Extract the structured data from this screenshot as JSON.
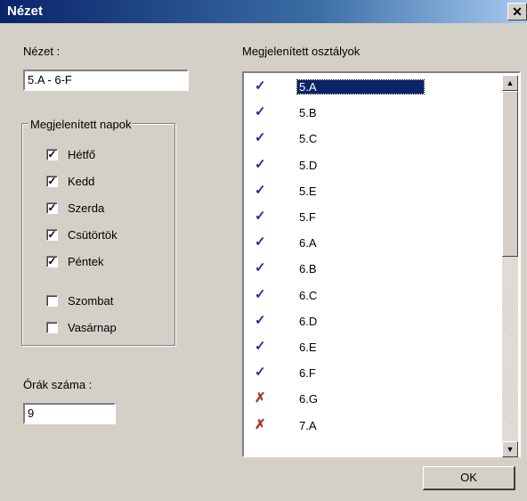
{
  "window": {
    "title": "Nézet",
    "close_glyph": "✕"
  },
  "view": {
    "label": "Nézet :",
    "value": "5.A - 6-F"
  },
  "days_group": {
    "legend": "Megjelenített napok",
    "days": [
      {
        "label": "Hétfő",
        "checked": true
      },
      {
        "label": "Kedd",
        "checked": true
      },
      {
        "label": "Szerda",
        "checked": true
      },
      {
        "label": "Csütörtök",
        "checked": true
      },
      {
        "label": "Péntek",
        "checked": true
      },
      {
        "label": "Szombat",
        "checked": false
      },
      {
        "label": "Vasárnap",
        "checked": false
      }
    ]
  },
  "hours": {
    "label": "Órák száma :",
    "value": "9"
  },
  "classes": {
    "label": "Megjelenített osztályok",
    "selected_index": 0,
    "items": [
      {
        "name": "5.A",
        "icon": "check-icon"
      },
      {
        "name": "5.B",
        "icon": "check-icon"
      },
      {
        "name": "5.C",
        "icon": "check-icon"
      },
      {
        "name": "5.D",
        "icon": "check-icon"
      },
      {
        "name": "5.E",
        "icon": "check-icon"
      },
      {
        "name": "5.F",
        "icon": "check-icon"
      },
      {
        "name": "6.A",
        "icon": "check-icon"
      },
      {
        "name": "6.B",
        "icon": "check-icon"
      },
      {
        "name": "6.C",
        "icon": "check-icon"
      },
      {
        "name": "6.D",
        "icon": "check-icon"
      },
      {
        "name": "6.E",
        "icon": "check-icon"
      },
      {
        "name": "6.F",
        "icon": "check-icon"
      },
      {
        "name": "6.G",
        "icon": "x-icon"
      },
      {
        "name": "7.A",
        "icon": "x-icon"
      }
    ]
  },
  "icon_glyphs": {
    "check-icon": "✓",
    "x-icon": "✗"
  },
  "ok_label": "OK"
}
